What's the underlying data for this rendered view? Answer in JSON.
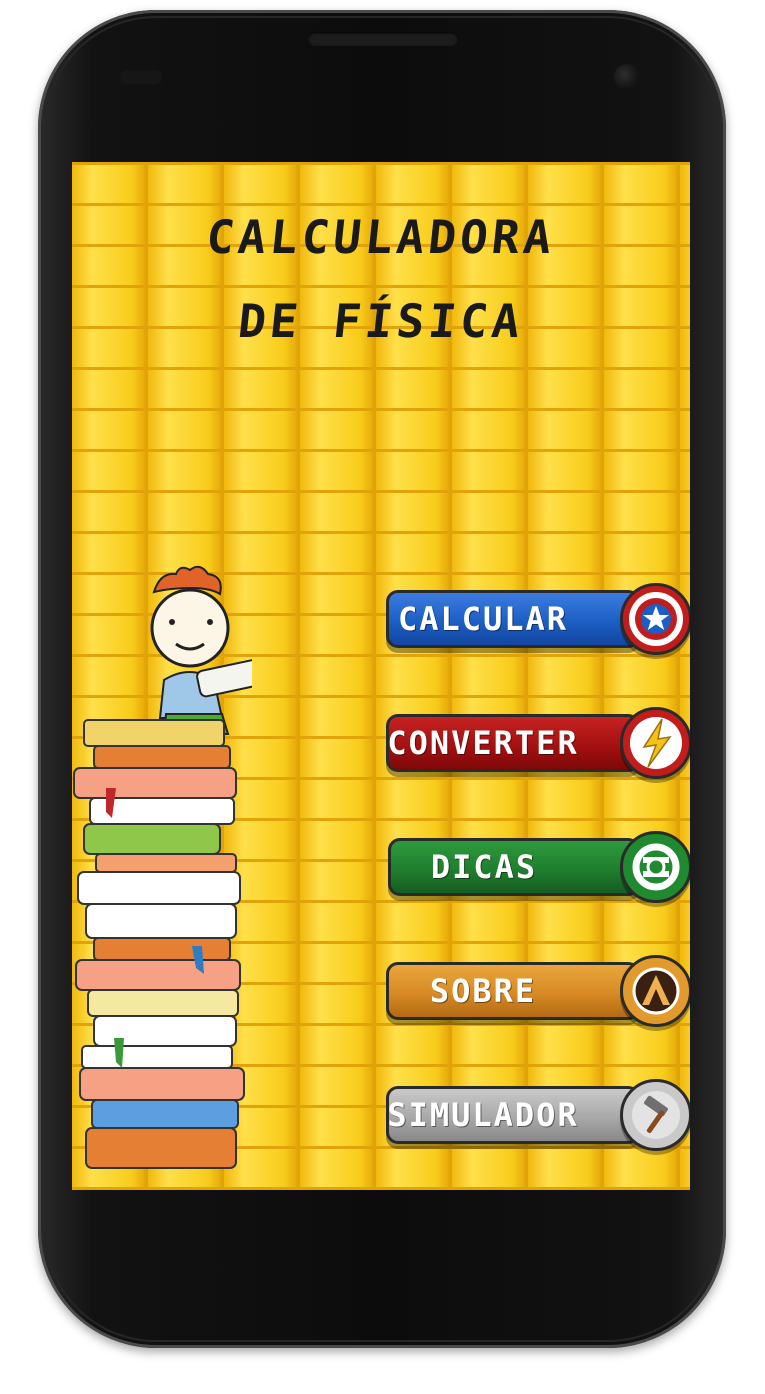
{
  "app": {
    "title_line_1": "CALCULADORA",
    "title_line_2": "DE FÍSICA"
  },
  "menu": {
    "items": [
      {
        "label": "CALCULAR",
        "icon": "shield-star-icon",
        "color": "#1c5fc4"
      },
      {
        "label": "CONVERTER",
        "icon": "lightning-bolt-icon",
        "color": "#a51111"
      },
      {
        "label": "DICAS",
        "icon": "lantern-ring-icon",
        "color": "#1f7f2e"
      },
      {
        "label": "SOBRE",
        "icon": "a-logo-icon",
        "color": "#d78a25"
      },
      {
        "label": "SIMULADOR",
        "icon": "hammer-icon",
        "color": "#a9a9a9"
      }
    ]
  },
  "theme": {
    "background": "#f4c411",
    "brick_mortar": "#e0a30a",
    "text": "#1a1a1a"
  },
  "illustration": {
    "description_icon": "boy-reading-on-books-icon"
  }
}
